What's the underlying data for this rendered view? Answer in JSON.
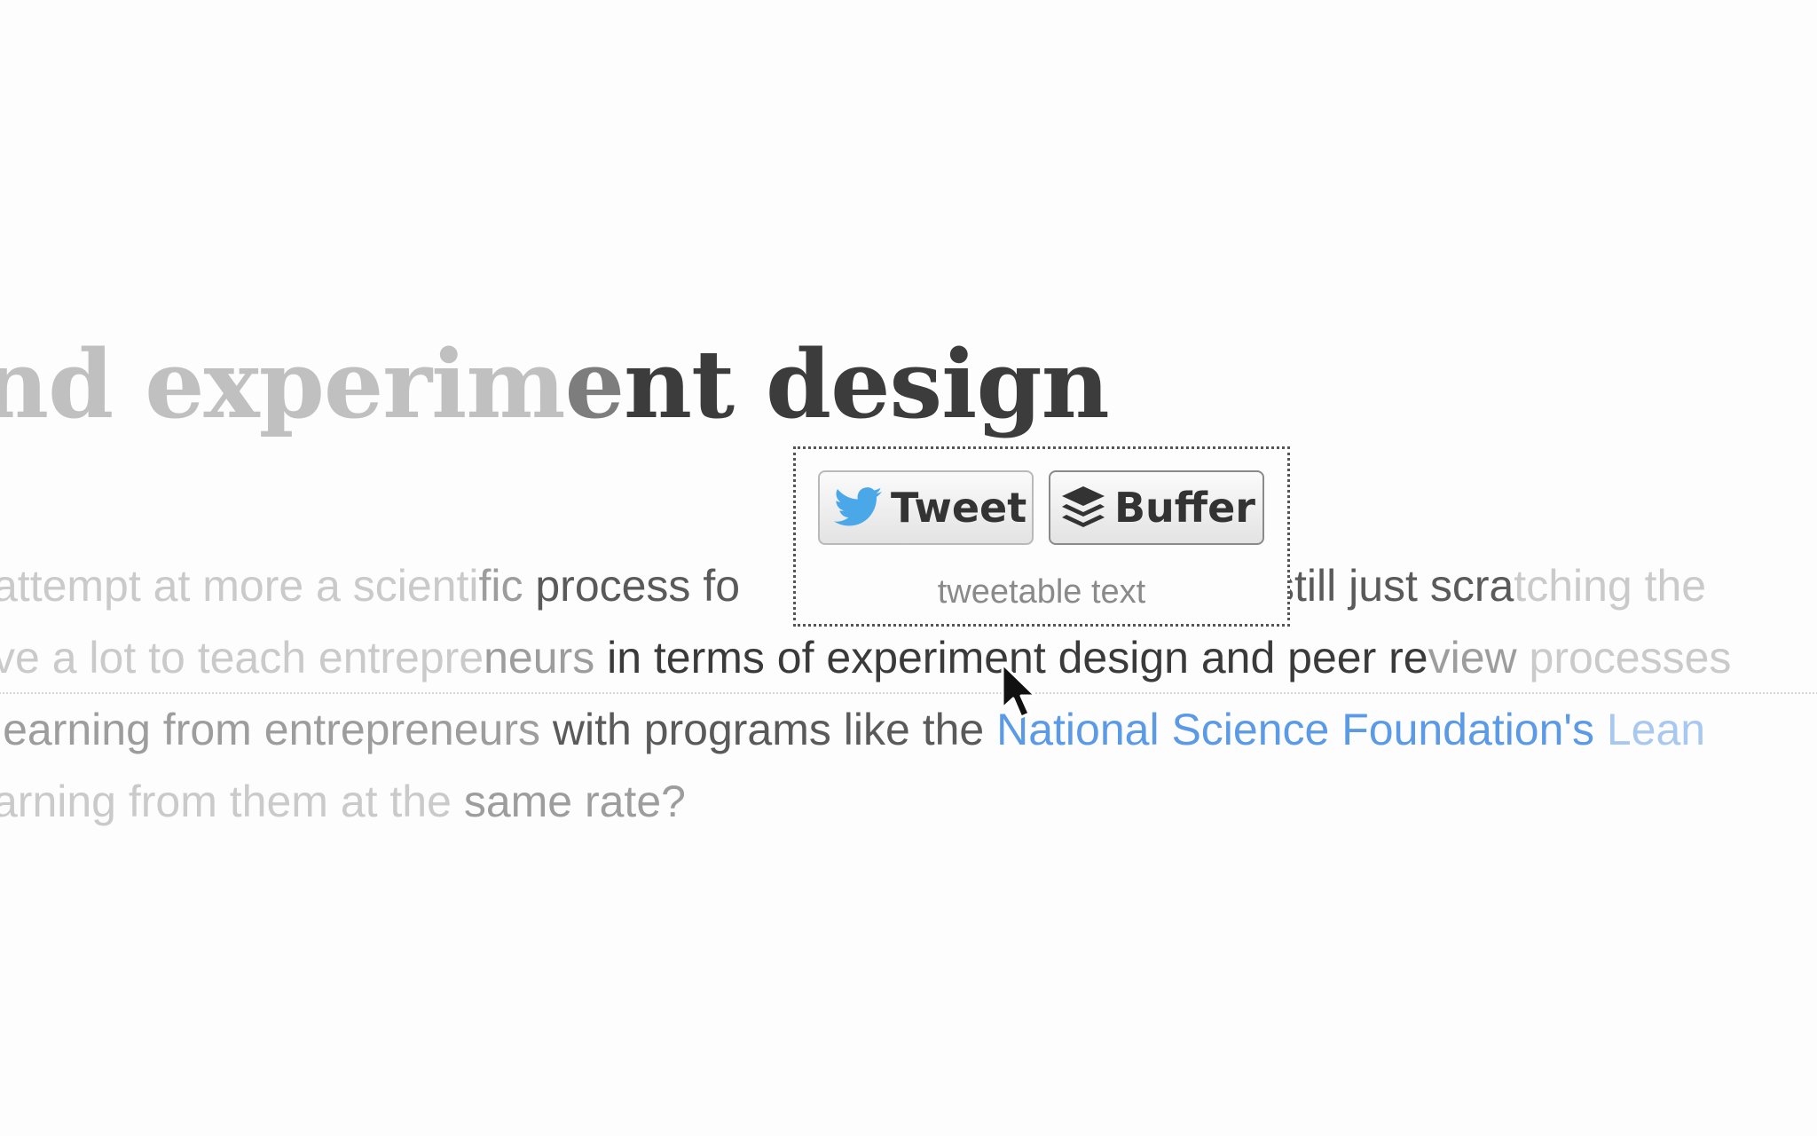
{
  "article": {
    "title_parts": [
      "nd experim",
      "e",
      "nt design"
    ],
    "paragraph": {
      "line1": [
        "attempt at more a scienti",
        "fic",
        " process fo",
        "still just scra",
        "tching the"
      ],
      "line2": [
        "ve a lot to teach entrepre",
        "neurs",
        " in terms of experiment design and peer re",
        "view",
        " processes"
      ],
      "line3": [
        "learning from entrepreneurs",
        " with programs like the",
        "National Science Foundation's",
        " Lean"
      ],
      "line4": [
        "arning from them at the ",
        "same rate?"
      ]
    }
  },
  "share_popup": {
    "tweet_label": "Tweet",
    "buffer_label": "Buffer",
    "caption": "tweetable text"
  },
  "colors": {
    "twitter_blue": "#4aa8e8",
    "link_blue": "#5b9ae6"
  },
  "icons": {
    "tweet": "twitter-bird-icon",
    "buffer": "buffer-stack-icon",
    "cursor": "mouse-pointer-icon"
  }
}
